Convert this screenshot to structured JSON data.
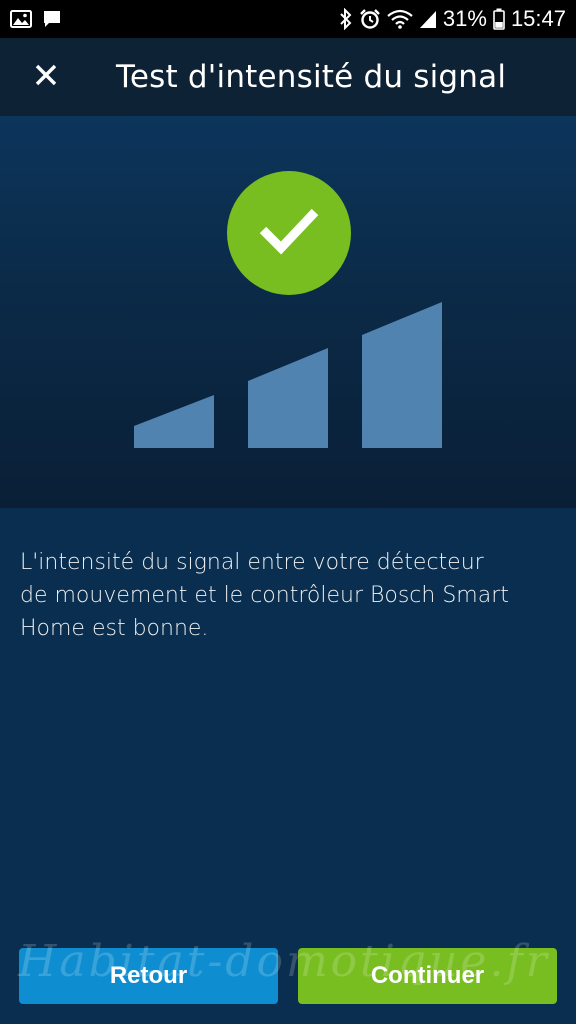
{
  "status_bar": {
    "battery_percent": "31%",
    "time": "15:47",
    "icons": [
      "image-icon",
      "message-icon",
      "bluetooth-icon",
      "alarm-icon",
      "wifi-icon",
      "cell-signal-icon",
      "battery-icon"
    ]
  },
  "header": {
    "title": "Test d'intensité du signal",
    "close_icon": "close-icon"
  },
  "hero": {
    "check_icon": "check-icon",
    "signal_level": 3,
    "signal_bars_total": 3,
    "colors": {
      "check_circle": "#78be20",
      "bars": "#5183b1"
    }
  },
  "message": {
    "line1": "L'intensité du signal entre votre détecteur",
    "line2": "de mouvement et le contrôleur Bosch Smart",
    "line3": "Home est bonne."
  },
  "buttons": {
    "back_label": "Retour",
    "next_label": "Continuer",
    "colors": {
      "back": "#0e8ed1",
      "next": "#78be20"
    }
  },
  "watermark": {
    "text": "Habitat-domotique.fr"
  }
}
